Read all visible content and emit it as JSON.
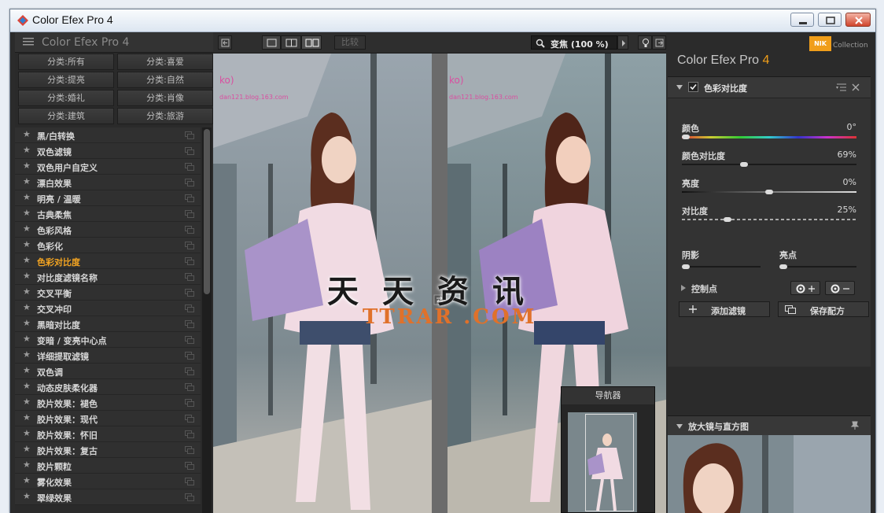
{
  "window": {
    "title": "Color Efex Pro 4"
  },
  "left_panel": {
    "title": "Color Efex Pro 4",
    "categories": [
      "分类:所有",
      "分类:喜爱",
      "分类:提亮",
      "分类:自然",
      "分类:婚礼",
      "分类:肖像",
      "分类:建筑",
      "分类:旅游"
    ],
    "filters": [
      "黑/白转换",
      "双色滤镜",
      "双色用户自定义",
      "漂白效果",
      "明亮 / 温暖",
      "古典柔焦",
      "色彩风格",
      "色彩化",
      "色彩对比度",
      "对比度滤镜名称",
      "交叉平衡",
      "交叉冲印",
      "黑暗对比度",
      "变暗 / 变亮中心点",
      "详细提取滤镜",
      "双色调",
      "动态皮肤柔化器",
      "胶片效果：褪色",
      "胶片效果：现代",
      "胶片效果：怀旧",
      "胶片效果：复古",
      "胶片颗粒",
      "雾化效果",
      "翠绿效果"
    ],
    "active_filter_index": 8
  },
  "toolbar": {
    "compare_label": "比较",
    "zoom_label": "变焦 (100 %)"
  },
  "canvas": {
    "watermark_cn": "天天资讯",
    "watermark_en": "TTRAR .COM",
    "photo_caption_left": "ko)",
    "photo_blog_left": "dan121.blog.163.com",
    "photo_caption_right": "ko)",
    "photo_blog_right": "dan121.blog.163.com"
  },
  "navigator": {
    "title": "导航器"
  },
  "right_panel": {
    "logo": "NIK",
    "collection": "Collection",
    "brand": "Color Efex Pro",
    "brand_version": "4",
    "filter_title": "色彩对比度",
    "params": [
      {
        "label": "颜色",
        "value": "0°",
        "level": 0.0
      },
      {
        "label": "颜色对比度",
        "value": "69%",
        "level": 0.35
      },
      {
        "label": "亮度",
        "value": "0%",
        "level": 0.5
      },
      {
        "label": "对比度",
        "value": "25%",
        "level": 0.25
      }
    ],
    "shadow_label": "阴影",
    "highlight_label": "亮点",
    "control_points_label": "控制点",
    "add_filter_label": "添加滤镜",
    "save_recipe_label": "保存配方",
    "loupe_title": "放大镜与直方图"
  },
  "colors": {
    "accent": "#f3a421",
    "panel": "#2b2b2b",
    "nik": "#f09e1a"
  }
}
